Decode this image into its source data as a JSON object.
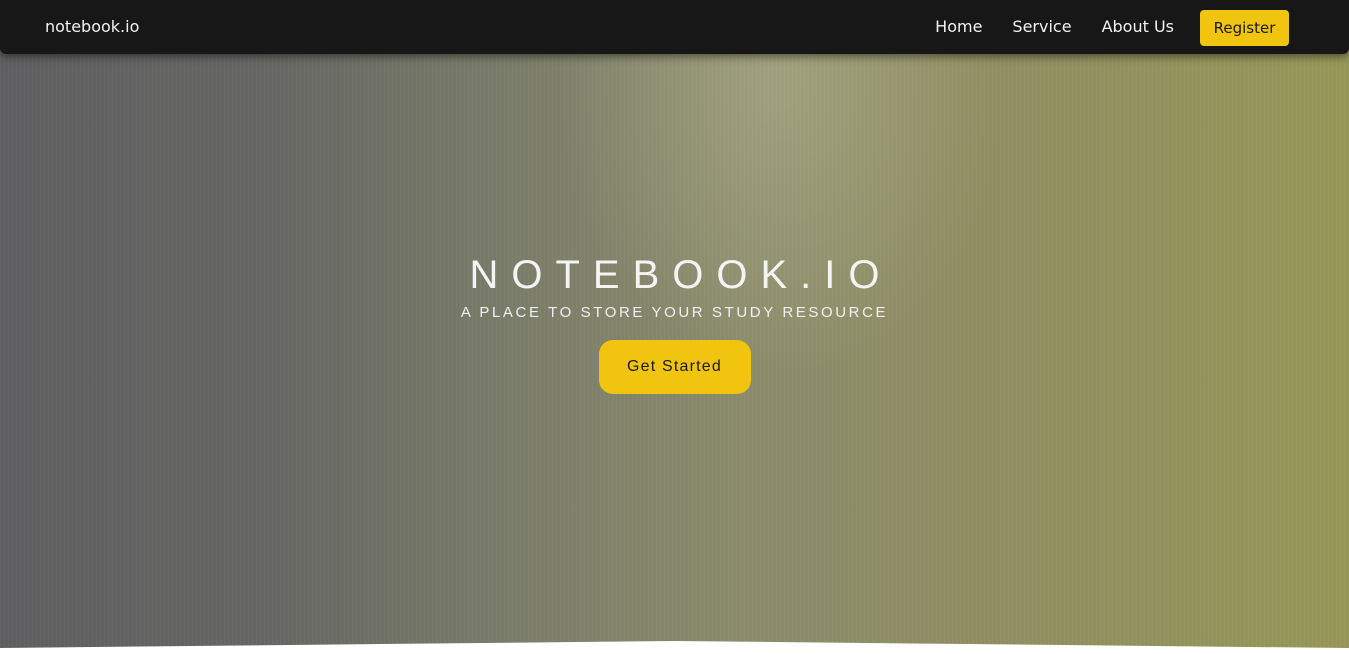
{
  "navbar": {
    "brand": "notebook.io",
    "links": [
      "Home",
      "Service",
      "About Us"
    ],
    "register_label": "Register"
  },
  "hero": {
    "title": "NOTEBOOK.IO",
    "subtitle": "A PLACE TO STORE YOUR STUDY RESOURCE",
    "cta_label": "Get Started"
  },
  "colors": {
    "navbar_bg": "#171717",
    "accent": "#f1c40f",
    "hero_left": "#5f5f61",
    "hero_right": "#979759"
  }
}
